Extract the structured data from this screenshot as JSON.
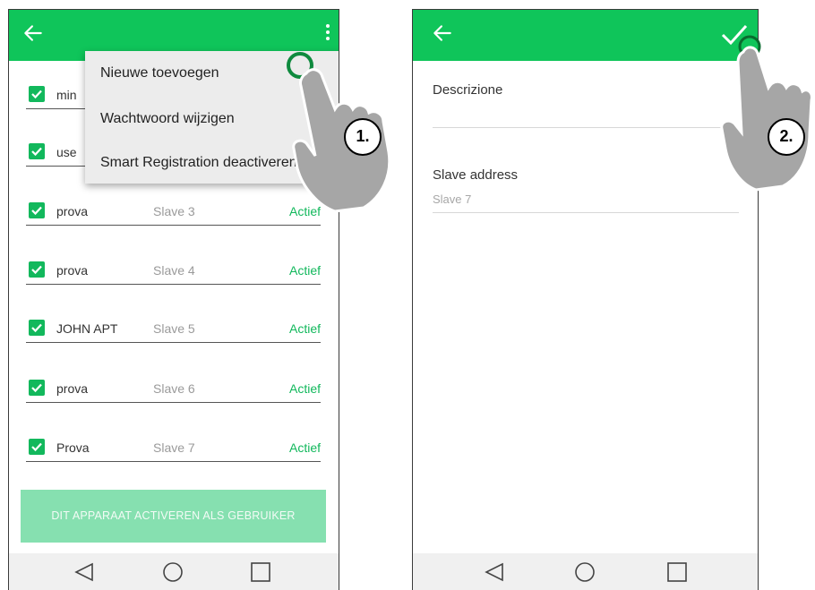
{
  "screen1": {
    "menu": {
      "items": [
        "Nieuwe toevoegen",
        "Wachtwoord wijzigen",
        "Smart Registration deactiveren"
      ]
    },
    "rows": [
      {
        "name": "min",
        "slave": "",
        "status": ""
      },
      {
        "name": "use",
        "slave": "",
        "status": ""
      },
      {
        "name": "prova",
        "slave": "Slave 3",
        "status": "Actief"
      },
      {
        "name": "prova",
        "slave": "Slave 4",
        "status": "Actief"
      },
      {
        "name": "JOHN APT",
        "slave": "Slave 5",
        "status": "Actief"
      },
      {
        "name": "prova",
        "slave": "Slave 6",
        "status": "Actief"
      },
      {
        "name": "Prova",
        "slave": "Slave 7",
        "status": "Actief"
      }
    ],
    "activate_button": "DIT APPARAAT ACTIVEREN ALS GEBRUIKER",
    "step_badge": "1."
  },
  "screen2": {
    "fields": {
      "description_label": "Descrizione",
      "description_value": "",
      "slave_address_label": "Slave address",
      "slave_address_value": "Slave 7"
    },
    "step_badge": "2."
  },
  "colors": {
    "accent": "#0fc55a",
    "status": "#12b85c",
    "button_disabled": "#86e0b0"
  },
  "icons": [
    "back-arrow-icon",
    "overflow-menu-icon",
    "checkbox-icon",
    "checkmark-icon",
    "nav-back-icon",
    "nav-home-icon",
    "nav-recents-icon",
    "hand-pointer-icon"
  ]
}
